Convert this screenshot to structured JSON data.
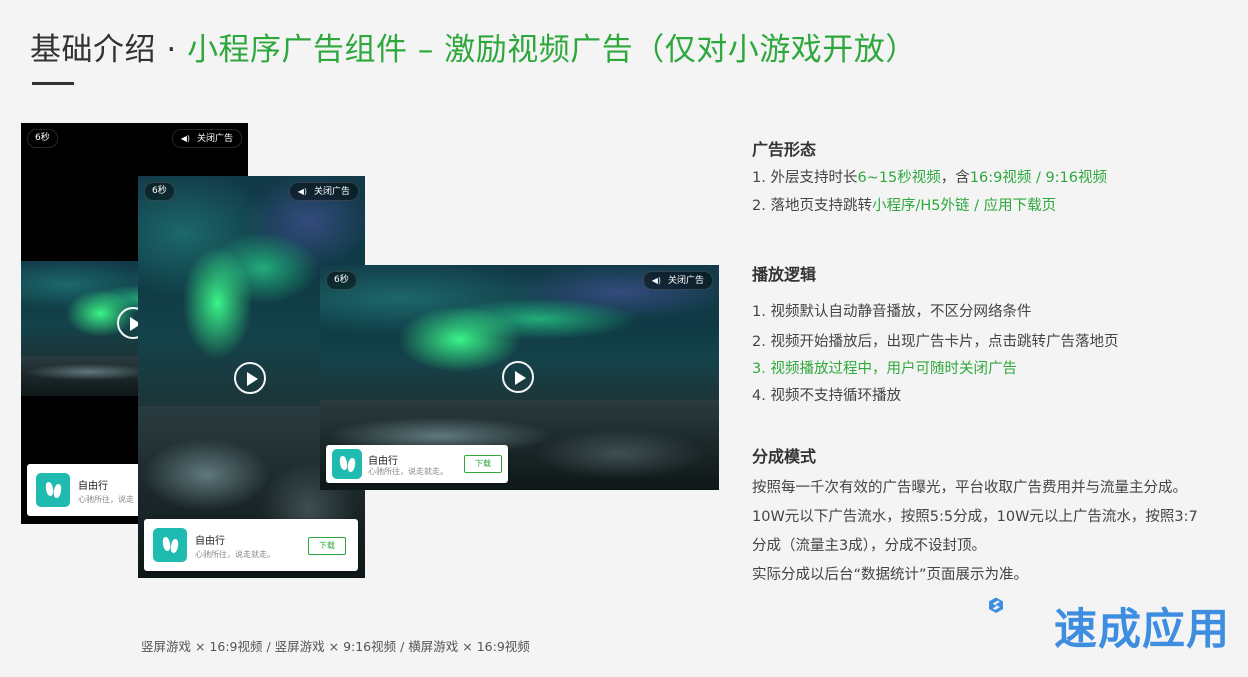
{
  "title": {
    "prefix": "基础介绍 · ",
    "main": "小程序广告组件 – 激励视频广告（仅对小游戏开放）"
  },
  "ad_preview": {
    "timer": "6秒",
    "close_label": "关闭广告",
    "app_name": "自由行",
    "app_desc": "心驰所往，说走就走。",
    "app_desc_truncated": "心驰所往，说走",
    "download_label": "下载"
  },
  "caption": "竖屏游戏 × 16:9视频 / 竖屏游戏 × 9:16视频 / 横屏游戏 × 16:9视频",
  "sections": {
    "form": {
      "title": "广告形态",
      "l1_a": "1. 外层支持时长",
      "l1_b": "6~15秒视频",
      "l1_c": "，含",
      "l1_d": "16:9视频 / 9:16视频",
      "l2_a": "2. 落地页支持跳转",
      "l2_b": "小程序/H5外链 / 应用下载页"
    },
    "logic": {
      "title": "播放逻辑",
      "items": [
        "1. 视频默认自动静音播放，不区分网络条件",
        "2. 视频开始播放后，出现广告卡片，点击跳转广告落地页",
        "3. 视频播放过程中，用户可随时关闭广告",
        "4. 视频不支持循环播放"
      ]
    },
    "share": {
      "title": "分成模式",
      "lines": [
        "按照每一千次有效的广告曝光，平台收取广告费用并与流量主分成。",
        "10W元以下广告流水，按照5:5分成，10W元以上广告流水，按照3:7",
        "分成（流量主3成），分成不设封顶。",
        "实际分成以后台“数据统计”页面展示为准。"
      ]
    }
  },
  "logo": {
    "text": "速成应用",
    "color": "#3d8de0"
  },
  "colors": {
    "accent_green": "#2ea83d",
    "text_dark": "#333333",
    "background": "#f4f4f4"
  }
}
